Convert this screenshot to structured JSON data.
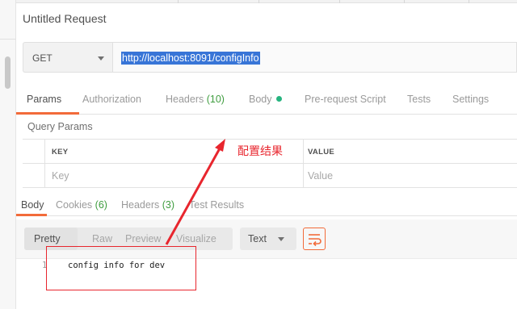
{
  "request": {
    "title": "Untitled Request",
    "method": "GET",
    "url": "http://localhost:8091/configInfo"
  },
  "request_tabs": [
    {
      "label": "Params"
    },
    {
      "label": "Authorization"
    },
    {
      "label": "Headers",
      "count": "(10)"
    },
    {
      "label": "Body"
    },
    {
      "label": "Pre-request Script"
    },
    {
      "label": "Tests"
    },
    {
      "label": "Settings"
    }
  ],
  "query_params": {
    "title": "Query Params",
    "columns": [
      "KEY",
      "VALUE"
    ],
    "placeholders": {
      "key": "Key",
      "value": "Value"
    }
  },
  "annotation": {
    "text": "配置结果",
    "color": "#e8262e"
  },
  "response_tabs": [
    {
      "label": "Body"
    },
    {
      "label": "Cookies",
      "count": "(6)"
    },
    {
      "label": "Headers",
      "count": "(3)"
    },
    {
      "label": "Test Results"
    }
  ],
  "response_toolbar": {
    "views": [
      "Pretty",
      "Raw",
      "Preview",
      "Visualize"
    ],
    "format": "Text",
    "wrap_icon": "wrap-lines-icon"
  },
  "response_body": {
    "line_number": "1",
    "line": "config info for dev"
  },
  "colors": {
    "accent": "#f26b3a",
    "count_green": "#3f9d3f",
    "body_dot": "#26b47f",
    "selection": "#3875d7"
  }
}
